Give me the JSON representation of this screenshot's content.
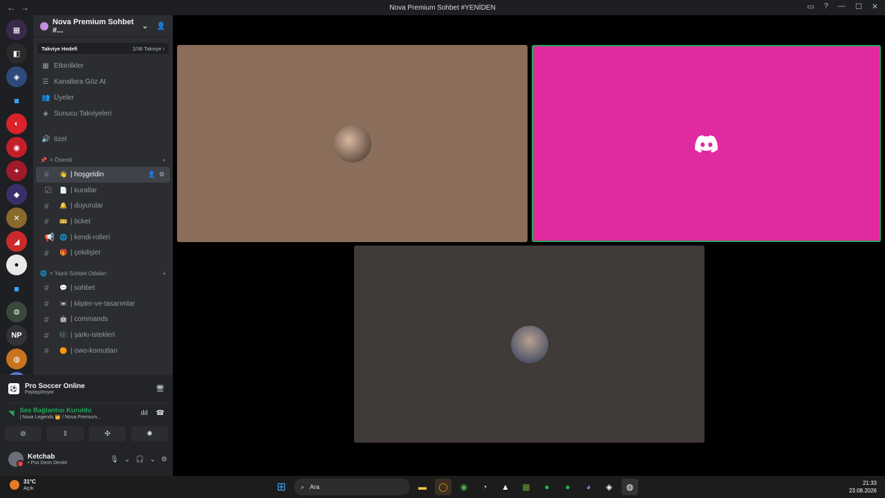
{
  "window": {
    "title": "Nova Premium Sohbet #YENİDEN",
    "back": "←",
    "forward": "→"
  },
  "server": {
    "name": "Nova Premium Sohbet #...",
    "boost_label": "Takviye Hedefi",
    "boost_progress": "2/36 Takviye"
  },
  "menu": [
    {
      "label": "Etkinlikler",
      "icon": "calendar-icon"
    },
    {
      "label": "Kanallara Göz At",
      "icon": "browse-icon"
    },
    {
      "label": "Üyeler",
      "icon": "members-icon"
    },
    {
      "label": "Sunucu Takviyeleri",
      "icon": "boost-icon"
    }
  ],
  "special_channel": "özel",
  "categories": [
    {
      "label": "× Önemli",
      "channels": [
        {
          "name": "| hoşgeldin",
          "emoji": "👋",
          "active": true
        },
        {
          "name": "| kurallar",
          "emoji": "📄"
        },
        {
          "name": "| duyurular",
          "emoji": "🔔"
        },
        {
          "name": "| ticket",
          "emoji": "🎫"
        },
        {
          "name": "| kendi-rolleri",
          "emoji": "🌐"
        },
        {
          "name": "| çekilişler",
          "emoji": "🎁"
        }
      ]
    },
    {
      "label": "× Yazılı Sohbet Odaları",
      "channels": [
        {
          "name": "| sohbet",
          "emoji": "💬"
        },
        {
          "name": "| klipler-ve-tasarımlar",
          "emoji": "📼"
        },
        {
          "name": "| commands",
          "emoji": "🤖"
        },
        {
          "name": "| şarkı-istekleri",
          "emoji": "🎼"
        },
        {
          "name": "| owo-komutları",
          "emoji": "🟠"
        }
      ]
    }
  ],
  "activity": {
    "title": "Pro Soccer Online",
    "subtitle": "Paylaşılmıyor"
  },
  "voice": {
    "status": "Ses Bağlantısı Kuruldu",
    "channel": "| Nova Legends 👑 / Nova Premium..."
  },
  "user": {
    "name": "Ketchab",
    "status": "• Pso Derin Devlet"
  },
  "guild_np": "NP",
  "taskbar": {
    "temperature": "31°C",
    "weather": "Açık",
    "search_placeholder": "Ara",
    "time": "21:33",
    "date": "23.08.2026"
  },
  "colors": {
    "tile1": "#8a6d5a",
    "tile2": "#e02ba0",
    "tile3": "#403a38",
    "accent_green": "#23a55a"
  }
}
